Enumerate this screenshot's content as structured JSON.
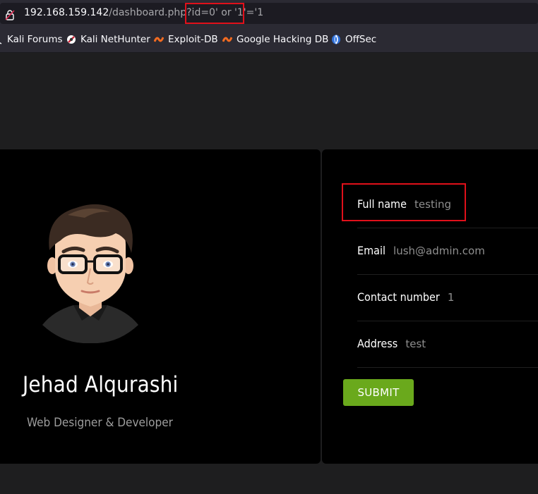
{
  "browser": {
    "url_host": "192.168.159.142",
    "url_path": "/dashboard.php?id=0' or '1'='1",
    "bookmarks": [
      {
        "label": "Kali Forums",
        "icon": "kali-forums-icon"
      },
      {
        "label": "Kali NetHunter",
        "icon": "nethunter-icon"
      },
      {
        "label": "Exploit-DB",
        "icon": "exploit-db-icon"
      },
      {
        "label": "Google Hacking DB",
        "icon": "ghdb-icon"
      },
      {
        "label": "OffSec",
        "icon": "offsec-icon"
      }
    ]
  },
  "profile": {
    "name": "Jehad Alqurashi",
    "role": "Web Designer & Developer"
  },
  "details": {
    "full_name_label": "Full name",
    "full_name_value": "testing",
    "email_label": "Email",
    "email_value": "lush@admin.com",
    "contact_label": "Contact number",
    "contact_value": "1",
    "address_label": "Address",
    "address_value": "test",
    "submit_label": "SUBMIT"
  },
  "colors": {
    "accent_green": "#6aa91c",
    "highlight_red": "#e0101a",
    "page_bg": "#1e1e1f",
    "card_bg": "#000000"
  }
}
